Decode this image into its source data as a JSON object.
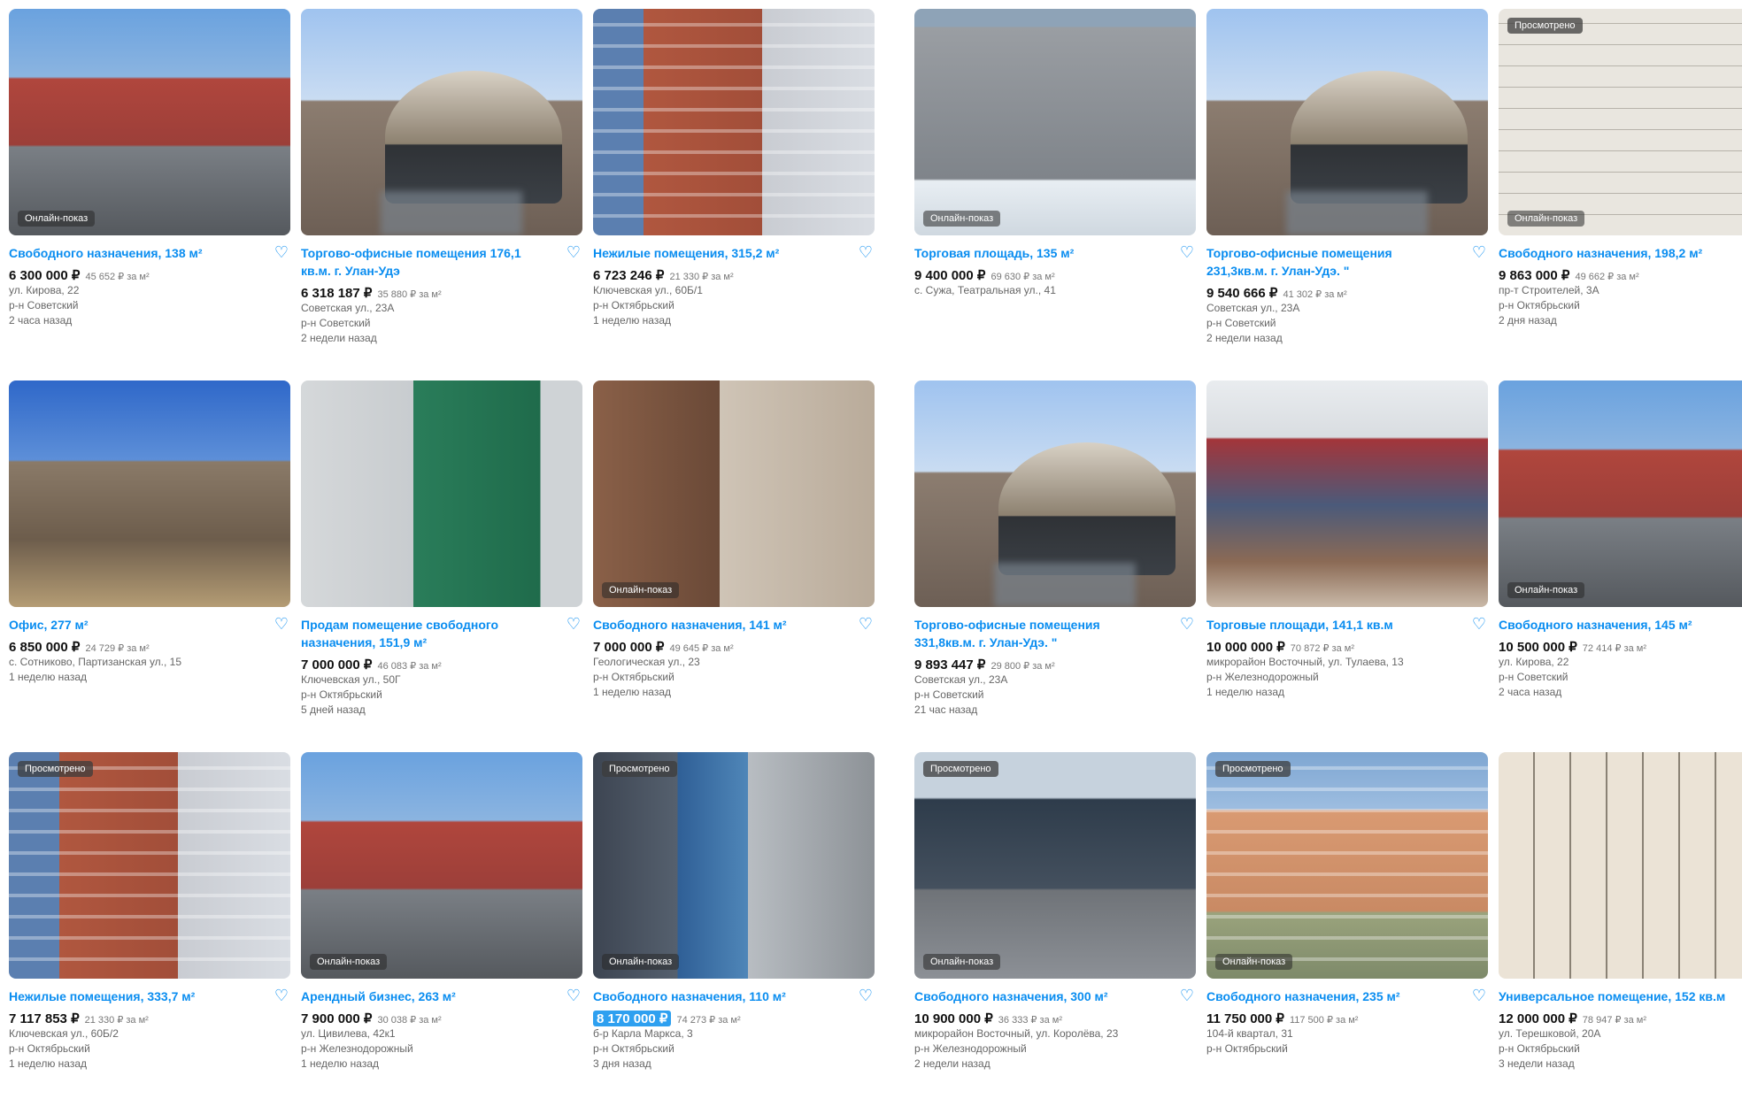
{
  "groups": [
    {
      "cards": [
        {
          "title": "Свободного назначения, 138 м²",
          "price": "6 300 000 ₽",
          "ppm": "45 652 ₽ за м²",
          "lines": [
            "ул. Кирова, 22",
            "р-н Советский",
            "2 часа назад"
          ],
          "badge_bottom": "Онлайн-показ",
          "badge_top": "",
          "photo": "street",
          "highlight": false
        },
        {
          "title": "Торгово-офисные помещения 176,1 кв.м. г. Улан-Удэ",
          "price": "6 318 187 ₽",
          "ppm": "35 880 ₽ за м²",
          "lines": [
            "Советская ул., 23А",
            "р-н Советский",
            "2 недели назад"
          ],
          "badge_bottom": "",
          "badge_top": "",
          "photo": "dome",
          "highlight": false
        },
        {
          "title": "Нежилые помещения, 315,2 м²",
          "price": "6 723 246 ₽",
          "ppm": "21 330 ₽ за м²",
          "lines": [
            "Ключевская ул., 60Б/1",
            "р-н Октябрьский",
            "1 неделю назад"
          ],
          "badge_bottom": "",
          "badge_top": "",
          "photo": "brick",
          "highlight": false
        },
        {
          "title": "Офис, 277 м²",
          "price": "6 850 000 ₽",
          "ppm": "24 729 ₽ за м²",
          "lines": [
            "с. Сотниково, Партизанская ул., 15",
            "1 неделю назад"
          ],
          "badge_bottom": "",
          "badge_top": "",
          "photo": "brown-house",
          "highlight": false
        },
        {
          "title": "Продам помещение свободного назначения, 151,9 м²",
          "price": "7 000 000 ₽",
          "ppm": "46 083 ₽ за м²",
          "lines": [
            "Ключевская ул., 50Г",
            "р-н Октябрьский",
            "5 дней назад"
          ],
          "badge_bottom": "",
          "badge_top": "",
          "photo": "green-door",
          "highlight": false
        },
        {
          "title": "Свободного назначения, 141 м²",
          "price": "7 000 000 ₽",
          "ppm": "49 645 ₽ за м²",
          "lines": [
            "Геологическая ул., 23",
            "р-н Октябрьский",
            "1 неделю назад"
          ],
          "badge_bottom": "Онлайн-показ",
          "badge_top": "",
          "photo": "brick2",
          "highlight": false
        },
        {
          "title": "Нежилые помещения, 333,7 м²",
          "price": "7 117 853 ₽",
          "ppm": "21 330 ₽ за м²",
          "lines": [
            "Ключевская ул., 60Б/2",
            "р-н Октябрьский",
            "1 неделю назад"
          ],
          "badge_bottom": "",
          "badge_top": "Просмотрено",
          "photo": "brick",
          "highlight": false
        },
        {
          "title": "Арендный бизнес, 263 м²",
          "price": "7 900 000 ₽",
          "ppm": "30 038 ₽ за м²",
          "lines": [
            "ул. Цивилева, 42к1",
            "р-н Железнодорожный",
            "1 неделю назад"
          ],
          "badge_bottom": "Онлайн-показ",
          "badge_top": "",
          "photo": "street",
          "highlight": false
        },
        {
          "title": "Свободного назначения, 110 м²",
          "price": "8 170 000 ₽",
          "ppm": "74 273 ₽ за м²",
          "lines": [
            "б-р Карла Маркса, 3",
            "р-н Октябрьский",
            "3 дня назад"
          ],
          "badge_bottom": "Онлайн-показ",
          "badge_top": "Просмотрено",
          "photo": "shop-front",
          "highlight": true
        }
      ]
    },
    {
      "cards": [
        {
          "title": "Торговая площадь, 135 м²",
          "price": "9 400 000 ₽",
          "ppm": "69 630 ₽ за м²",
          "lines": [
            "с. Сужа, Театральная ул., 41"
          ],
          "badge_bottom": "Онлайн-показ",
          "badge_top": "",
          "photo": "gray-block",
          "highlight": false
        },
        {
          "title": "Торгово-офисные помещения 231,3кв.м. г. Улан-Удэ. \"",
          "price": "9 540 666 ₽",
          "ppm": "41 302 ₽ за м²",
          "lines": [
            "Советская ул., 23А",
            "р-н Советский",
            "2 недели назад"
          ],
          "badge_bottom": "",
          "badge_top": "",
          "photo": "dome",
          "highlight": false
        },
        {
          "title": "Свободного назначения, 198,2 м²",
          "price": "9 863 000 ₽",
          "ppm": "49 662 ₽ за м²",
          "lines": [
            "пр-т Строителей, 3А",
            "р-н Октябрьский",
            "2 дня назад"
          ],
          "badge_bottom": "Онлайн-показ",
          "badge_top": "Просмотрено",
          "photo": "plan",
          "highlight": false
        },
        {
          "title": "Торгово-офисные помещения 331,8кв.м. г. Улан-Удэ. \"",
          "price": "9 893 447 ₽",
          "ppm": "29 800 ₽ за м²",
          "lines": [
            "Советская ул., 23А",
            "р-н Советский",
            "21 час назад"
          ],
          "badge_bottom": "",
          "badge_top": "",
          "photo": "dome",
          "highlight": false
        },
        {
          "title": "Торговые площади, 141,1 кв.м",
          "price": "10 000 000 ₽",
          "ppm": "70 872 ₽ за м²",
          "lines": [
            "микрорайон Восточный, ул. Тулаева, 13",
            "р-н Железнодорожный",
            "1 неделю назад"
          ],
          "badge_bottom": "",
          "badge_top": "",
          "photo": "store",
          "highlight": false
        },
        {
          "title": "Свободного назначения, 145 м²",
          "price": "10 500 000 ₽",
          "ppm": "72 414 ₽ за м²",
          "lines": [
            "ул. Кирова, 22",
            "р-н Советский",
            "2 часа назад"
          ],
          "badge_bottom": "Онлайн-показ",
          "badge_top": "",
          "photo": "street",
          "highlight": false
        },
        {
          "title": "Свободного назначения, 300 м²",
          "price": "10 900 000 ₽",
          "ppm": "36 333 ₽ за м²",
          "lines": [
            "микрорайон Восточный, ул. Королёва, 23",
            "р-н Железнодорожный",
            "2 недели назад"
          ],
          "badge_bottom": "Онлайн-показ",
          "badge_top": "Просмотрено",
          "photo": "dark-house",
          "highlight": false
        },
        {
          "title": "Свободного назначения, 235 м²",
          "price": "11 750 000 ₽",
          "ppm": "117 500 ₽ за м²",
          "lines": [
            "104-й квартал, 31",
            "р-н Октябрьский"
          ],
          "badge_bottom": "Онлайн-показ",
          "badge_top": "Просмотрено",
          "photo": "blocks",
          "highlight": false
        },
        {
          "title": "Универсальное помещение, 152 кв.м",
          "price": "12 000 000 ₽",
          "ppm": "78 947 ₽ за м²",
          "lines": [
            "ул. Терешковой, 20А",
            "р-н Октябрьский",
            "3 недели назад"
          ],
          "badge_bottom": "",
          "badge_top": "",
          "photo": "plan2",
          "highlight": false
        }
      ]
    }
  ],
  "icons": {
    "favorite": "heart-outline-icon"
  },
  "colors": {
    "link": "#0a8df0",
    "highlight": "#2ea0f0"
  }
}
